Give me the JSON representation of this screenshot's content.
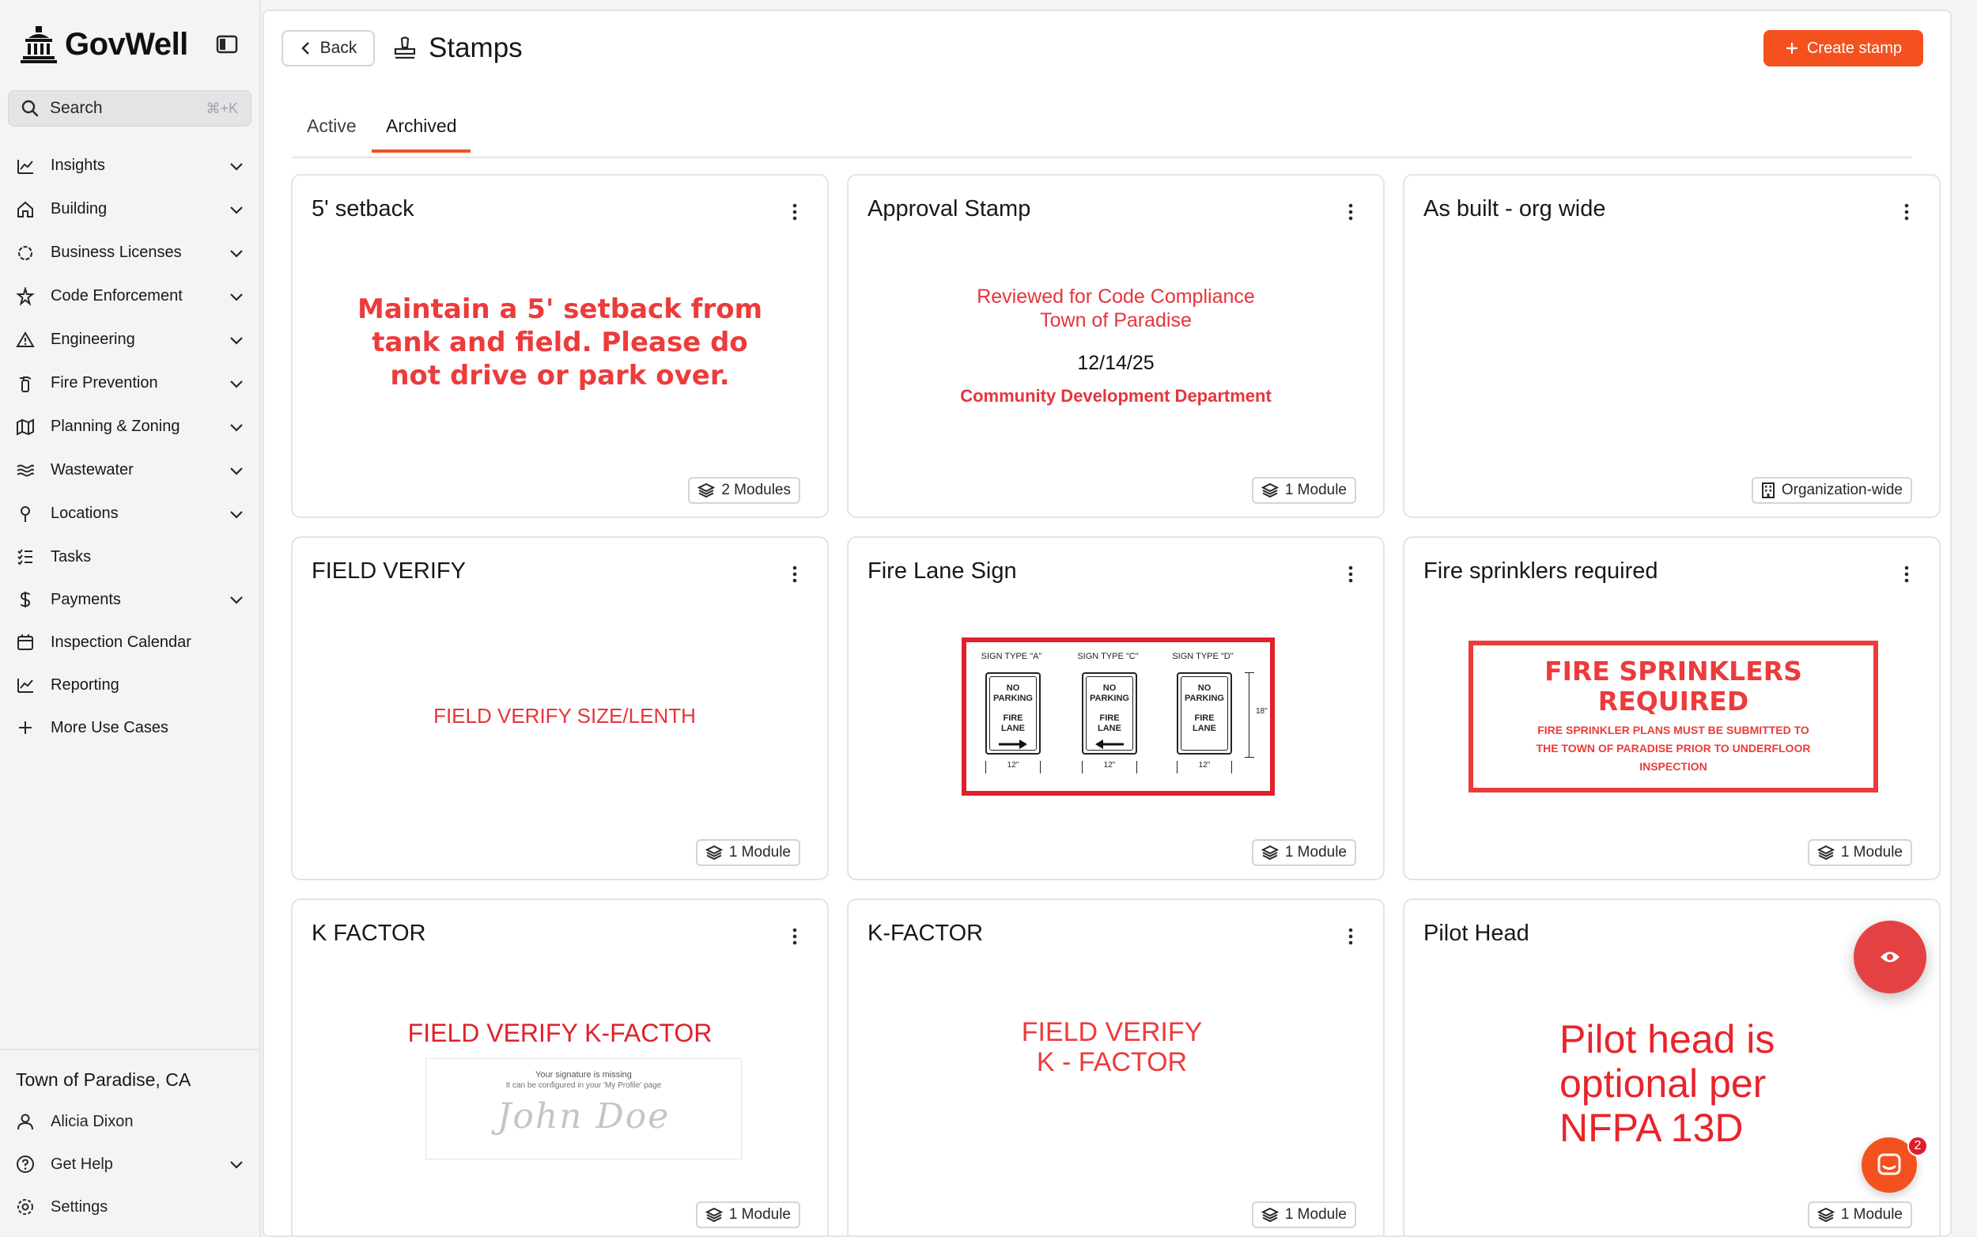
{
  "brand": {
    "name": "GovWell"
  },
  "search": {
    "label": "Search",
    "shortcut": "⌘+K"
  },
  "nav": [
    {
      "label": "Insights",
      "icon": "chart-line-icon",
      "expandable": true
    },
    {
      "label": "Building",
      "icon": "home-icon",
      "expandable": true
    },
    {
      "label": "Business Licenses",
      "icon": "badge-icon",
      "expandable": true
    },
    {
      "label": "Code Enforcement",
      "icon": "alert-star-icon",
      "expandable": true
    },
    {
      "label": "Engineering",
      "icon": "warning-triangle-icon",
      "expandable": true
    },
    {
      "label": "Fire Prevention",
      "icon": "fire-extinguisher-icon",
      "expandable": true
    },
    {
      "label": "Planning & Zoning",
      "icon": "map-icon",
      "expandable": true
    },
    {
      "label": "Wastewater",
      "icon": "waves-icon",
      "expandable": true
    },
    {
      "label": "Locations",
      "icon": "map-pin-icon",
      "expandable": true
    },
    {
      "label": "Tasks",
      "icon": "checklist-icon",
      "expandable": false
    },
    {
      "label": "Payments",
      "icon": "dollar-icon",
      "expandable": true
    },
    {
      "label": "Inspection Calendar",
      "icon": "calendar-icon",
      "expandable": false
    },
    {
      "label": "Reporting",
      "icon": "chart-line-icon",
      "expandable": false
    },
    {
      "label": "More Use Cases",
      "icon": "plus-icon",
      "expandable": false
    }
  ],
  "footer": {
    "org": "Town of Paradise, CA",
    "user": "Alicia Dixon",
    "help": "Get Help",
    "settings": "Settings"
  },
  "header": {
    "back_label": "Back",
    "title": "Stamps",
    "create_label": "Create stamp"
  },
  "tabs": [
    {
      "label": "Active",
      "active": false
    },
    {
      "label": "Archived",
      "active": true
    }
  ],
  "cards": [
    {
      "title": "5' setback",
      "badge": "2 Modules",
      "badge_icon": "layers-icon",
      "stamp": {
        "lines": [
          "Maintain a 5' setback from",
          "tank and field. Please do",
          "not drive or park over."
        ]
      }
    },
    {
      "title": "Approval Stamp",
      "badge": "1 Module",
      "badge_icon": "layers-icon",
      "stamp": {
        "line1": "Reviewed for Code Compliance",
        "line2": "Town of Paradise",
        "date": "12/14/25",
        "dept": "Community Development Department"
      }
    },
    {
      "title": "As built - org wide",
      "badge": "Organization-wide",
      "badge_icon": "building-icon",
      "stamp": {}
    },
    {
      "title": "FIELD VERIFY",
      "badge": "1 Module",
      "badge_icon": "layers-icon",
      "stamp": {
        "text": "FIELD VERIFY SIZE/LENTH"
      }
    },
    {
      "title": "Fire Lane Sign",
      "badge": "1 Module",
      "badge_icon": "layers-icon",
      "stamp": {
        "signs": [
          {
            "type": "SIGN TYPE \"A\"",
            "l1": "NO",
            "l2": "PARKING",
            "l3": "FIRE LANE",
            "dim": "12\"",
            "arrow": "right"
          },
          {
            "type": "SIGN TYPE \"C\"",
            "l1": "NO",
            "l2": "PARKING",
            "l3": "FIRE LANE",
            "dim": "12\"",
            "arrow": "left"
          },
          {
            "type": "SIGN TYPE \"D\"",
            "l1": "NO",
            "l2": "PARKING",
            "l3": "FIRE LANE",
            "dim": "12\"",
            "arrow": "none"
          }
        ],
        "height_dim": "18\""
      }
    },
    {
      "title": "Fire sprinklers required",
      "badge": "1 Module",
      "badge_icon": "layers-icon",
      "stamp": {
        "head1": "FIRE SPRINKLERS",
        "head2": "REQUIRED",
        "sub": [
          "FIRE SPRINKLER PLANS MUST BE SUBMITTED TO",
          "THE TOWN OF PARADISE PRIOR TO UNDERFLOOR",
          "INSPECTION"
        ]
      }
    },
    {
      "title": "K FACTOR",
      "badge": "1 Module",
      "badge_icon": "layers-icon",
      "stamp": {
        "text": "FIELD VERIFY K-FACTOR",
        "sig_missing": "Your signature is missing",
        "sig_hint": "It can be configured in your 'My Profile' page",
        "sig_sample": "John Doe"
      }
    },
    {
      "title": "K-FACTOR",
      "badge": "1 Module",
      "badge_icon": "layers-icon",
      "stamp": {
        "line1": "FIELD VERIFY",
        "line2": "K - FACTOR"
      }
    },
    {
      "title": "Pilot Head",
      "badge": "1 Module",
      "badge_icon": "layers-icon",
      "stamp": {
        "lines": [
          "Pilot head is",
          "optional per",
          "NFPA 13D"
        ]
      }
    }
  ],
  "chat": {
    "unread": "2"
  },
  "colors": {
    "accent": "#f4511e",
    "stamp_red": "#e8333a",
    "fab": "#e44242"
  }
}
